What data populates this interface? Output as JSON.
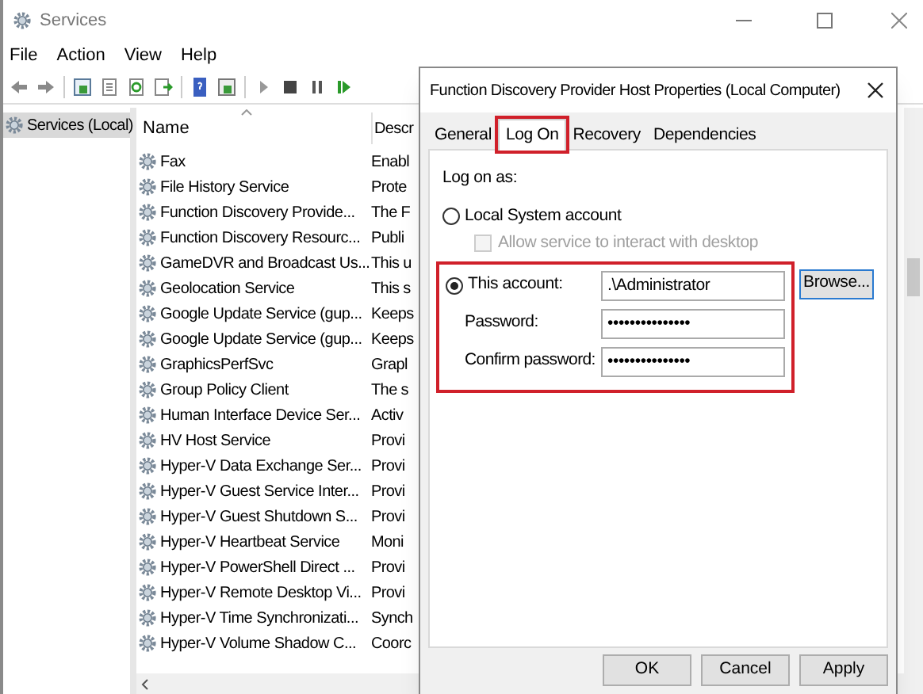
{
  "window": {
    "title": "Services"
  },
  "menu": [
    "File",
    "Action",
    "View",
    "Help"
  ],
  "tree": {
    "items": [
      {
        "label": "Services (Local)",
        "selected": true
      }
    ]
  },
  "services": {
    "columns": [
      "Name",
      "Descr"
    ],
    "rows": [
      {
        "name": "Fax",
        "description": "Enabl"
      },
      {
        "name": "File History Service",
        "description": "Prote"
      },
      {
        "name": "Function Discovery Provide...",
        "description": "The F"
      },
      {
        "name": "Function Discovery Resourc...",
        "description": "Publi"
      },
      {
        "name": "GameDVR and Broadcast Us...",
        "description": "This u"
      },
      {
        "name": "Geolocation Service",
        "description": "This s"
      },
      {
        "name": "Google Update Service (gup...",
        "description": "Keeps"
      },
      {
        "name": "Google Update Service (gup...",
        "description": "Keeps"
      },
      {
        "name": "GraphicsPerfSvc",
        "description": "Grapl"
      },
      {
        "name": "Group Policy Client",
        "description": "The s"
      },
      {
        "name": "Human Interface Device Ser...",
        "description": "Activ"
      },
      {
        "name": "HV Host Service",
        "description": "Provi"
      },
      {
        "name": "Hyper-V Data Exchange Ser...",
        "description": "Provi"
      },
      {
        "name": "Hyper-V Guest Service Inter...",
        "description": "Provi"
      },
      {
        "name": "Hyper-V Guest Shutdown S...",
        "description": "Provi"
      },
      {
        "name": "Hyper-V Heartbeat Service",
        "description": "Moni"
      },
      {
        "name": "Hyper-V PowerShell Direct ...",
        "description": "Provi"
      },
      {
        "name": "Hyper-V Remote Desktop Vi...",
        "description": "Provi"
      },
      {
        "name": "Hyper-V Time Synchronizati...",
        "description": "Synch"
      },
      {
        "name": "Hyper-V Volume Shadow C...",
        "description": "Coorc"
      }
    ]
  },
  "dialog": {
    "title": "Function Discovery Provider Host Properties (Local Computer)",
    "tabs": [
      {
        "label": "General",
        "selected": false,
        "highlighted": false
      },
      {
        "label": "Log On",
        "selected": true,
        "highlighted": true
      },
      {
        "label": "Recovery",
        "selected": false,
        "highlighted": false
      },
      {
        "label": "Dependencies",
        "selected": false,
        "highlighted": false
      }
    ],
    "log_on_as_label": "Log on as:",
    "local_system": {
      "label": "Local System account",
      "selected": false
    },
    "interact_checkbox": {
      "label": "Allow service to interact with desktop",
      "checked": false,
      "disabled": true
    },
    "this_account": {
      "label": "This account:",
      "selected": true,
      "value": ".\\Administrator",
      "highlighted": true
    },
    "browse_button": "Browse...",
    "password": {
      "label": "Password:",
      "value": "•••••••••••••••"
    },
    "confirm_password": {
      "label": "Confirm password:",
      "value": "•••••••••••••••"
    },
    "buttons": [
      "OK",
      "Cancel",
      "Apply"
    ]
  }
}
